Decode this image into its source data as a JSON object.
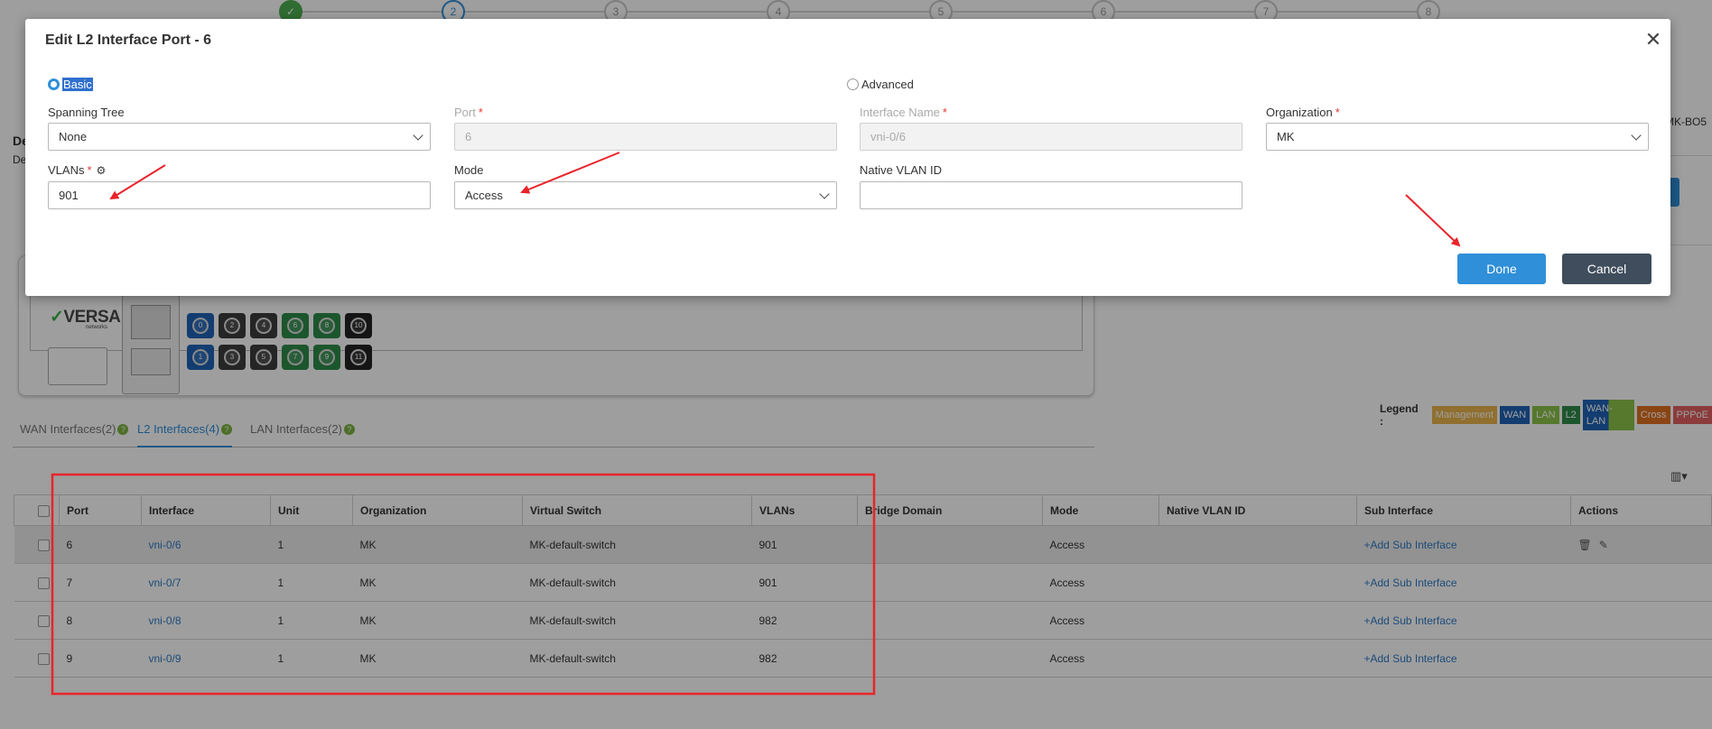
{
  "stepper": {
    "steps": [
      "✓",
      "2",
      "3",
      "4",
      "5",
      "6",
      "7",
      "8"
    ],
    "current": 2
  },
  "background": {
    "edge_title": "De",
    "edge_sub": "De",
    "right_label": "MK-BO5",
    "device": {
      "logo": "VERSA",
      "logo_sub": "networks",
      "ports_top": [
        "0",
        "2",
        "4",
        "6",
        "8",
        "10"
      ],
      "ports_bottom": [
        "1",
        "3",
        "5",
        "7",
        "9",
        "11"
      ]
    },
    "legend": {
      "title": "Legend :",
      "items": [
        {
          "label": "Management",
          "color": "#e9b44c"
        },
        {
          "label": "WAN",
          "color": "#1f63b5"
        },
        {
          "label": "LAN",
          "color": "#8bc34a"
        },
        {
          "label": "L2",
          "color": "#2e8b4a"
        },
        {
          "label": "WAN-LAN",
          "color": "#4f7fc9"
        },
        {
          "label": "Cross",
          "color": "#e07020"
        },
        {
          "label": "PPPoE",
          "color": "#e06060"
        }
      ]
    },
    "tabs": [
      {
        "label": "WAN Interfaces(2)"
      },
      {
        "label": "L2 Interfaces(4)"
      },
      {
        "label": "LAN Interfaces(2)"
      }
    ],
    "tab_badge": "?",
    "table": {
      "columns": [
        "Port",
        "Interface",
        "Unit",
        "Organization",
        "Virtual Switch",
        "VLANs",
        "Bridge Domain",
        "Mode",
        "Native VLAN ID",
        "Sub Interface",
        "Actions"
      ],
      "rows": [
        {
          "port": "6",
          "interface": "vni-0/6",
          "unit": "1",
          "org": "MK",
          "vswitch": "MK-default-switch",
          "vlans": "901",
          "bridge": "",
          "mode": "Access",
          "native": "",
          "sub": "+Add Sub Interface"
        },
        {
          "port": "7",
          "interface": "vni-0/7",
          "unit": "1",
          "org": "MK",
          "vswitch": "MK-default-switch",
          "vlans": "901",
          "bridge": "",
          "mode": "Access",
          "native": "",
          "sub": "+Add Sub Interface"
        },
        {
          "port": "8",
          "interface": "vni-0/8",
          "unit": "1",
          "org": "MK",
          "vswitch": "MK-default-switch",
          "vlans": "982",
          "bridge": "",
          "mode": "Access",
          "native": "",
          "sub": "+Add Sub Interface"
        },
        {
          "port": "9",
          "interface": "vni-0/9",
          "unit": "1",
          "org": "MK",
          "vswitch": "MK-default-switch",
          "vlans": "982",
          "bridge": "",
          "mode": "Access",
          "native": "",
          "sub": "+Add Sub Interface"
        }
      ]
    }
  },
  "modal": {
    "title": "Edit L2 Interface Port - 6",
    "close_icon": "close-icon",
    "radio_basic": "Basic",
    "radio_advanced": "Advanced",
    "fields": {
      "spanning_tree": {
        "label": "Spanning Tree",
        "value": "None"
      },
      "port": {
        "label": "Port",
        "value": "6"
      },
      "interface_name": {
        "label": "Interface Name",
        "value": "vni-0/6"
      },
      "organization": {
        "label": "Organization",
        "value": "MK"
      },
      "vlans": {
        "label": "VLANs",
        "value": "901"
      },
      "mode": {
        "label": "Mode",
        "value": "Access"
      },
      "native_vlan": {
        "label": "Native VLAN ID",
        "value": ""
      }
    },
    "required_mark": "*",
    "done_label": "Done",
    "cancel_label": "Cancel"
  },
  "annotation_color": "#e8242a"
}
